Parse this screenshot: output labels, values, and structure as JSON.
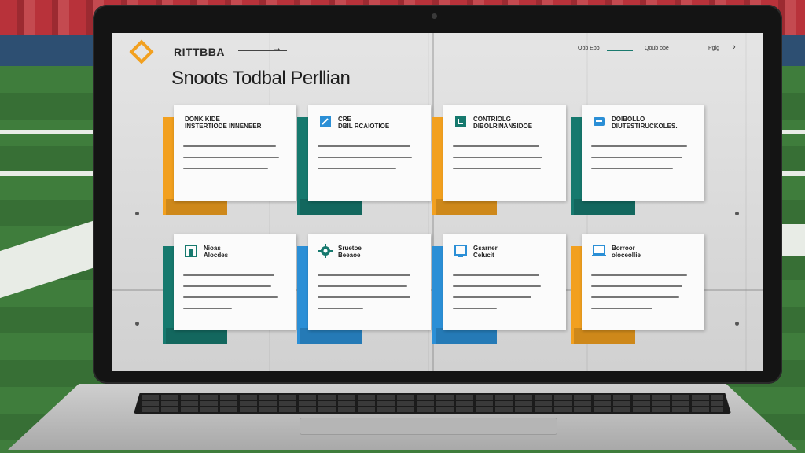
{
  "colors": {
    "orange": "#f2a01f",
    "teal": "#16796e",
    "blue": "#2b8fd6",
    "dark_teal": "#136b5f"
  },
  "header": {
    "brand": "RITTBBA",
    "logo_icon": "diamond-logo-icon",
    "page_title": "Snoots Todbal Perllian",
    "nav": [
      "Obb Ebb",
      "Qoub obe",
      "Pglg"
    ],
    "nav_right_icon": "chevron-right-icon"
  },
  "cards": [
    {
      "title": "DONK KIDE\nINSTERTIODE INNENEER",
      "icon": "none",
      "accent": "orange"
    },
    {
      "title": "CRE\nDBIL RCAIOTIOE",
      "icon": "document-icon",
      "accent": "teal"
    },
    {
      "title": "CONTRIOLG\nDIBOLRINANSIDOE",
      "icon": "clipboard-icon",
      "accent": "orange"
    },
    {
      "title": "DOIBOLLO\nDIUTESTIRUCKOLES.",
      "icon": "chat-icon",
      "accent": "teal"
    },
    {
      "title": "Nioas\nAlocdes",
      "icon": "image-icon",
      "accent": "teal"
    },
    {
      "title": "Sruetoe\nBeeaoe",
      "icon": "gear-icon",
      "accent": "blue"
    },
    {
      "title": "Gsarner\nCelucit",
      "icon": "monitor-icon",
      "accent": "blue"
    },
    {
      "title": "Borroor\noloceollie",
      "icon": "laptop-icon",
      "accent": "orange"
    }
  ]
}
